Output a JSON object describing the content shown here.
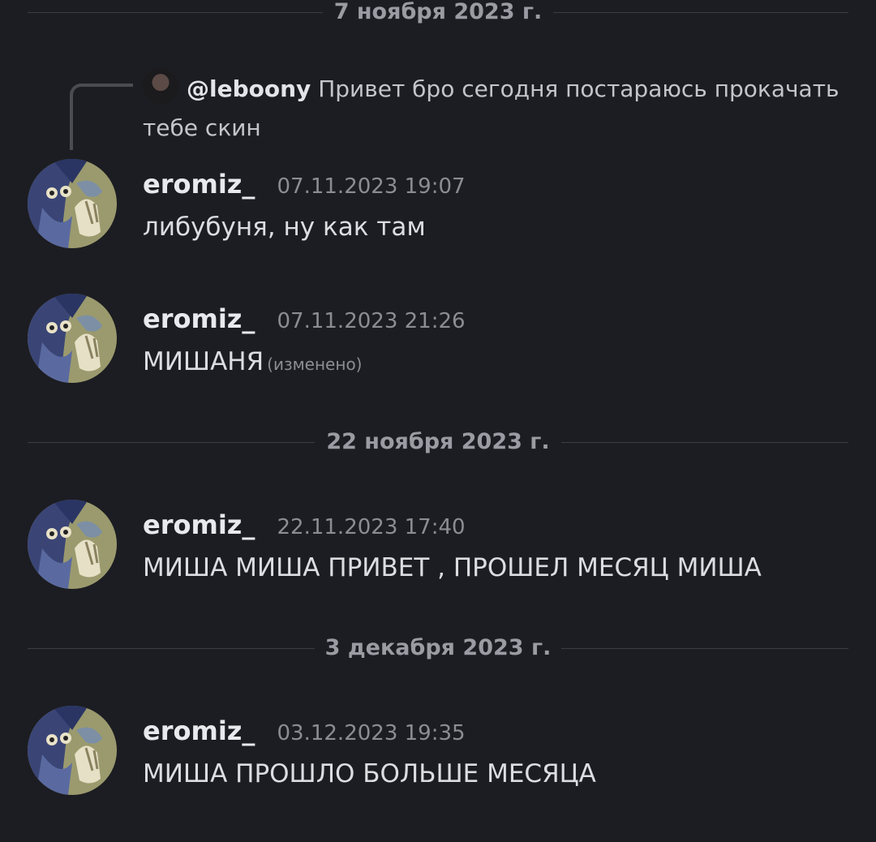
{
  "dates": [
    "7 ноября 2023 г.",
    "22 ноября 2023 г.",
    "3 декабря 2023 г."
  ],
  "reply": {
    "mention": "@leboony",
    "text": "Привет бро сегодня постараюсь прокачать тебе скин"
  },
  "messages": [
    {
      "author": "eromiz_",
      "time": "07.11.2023 19:07",
      "text": "либубуня, ну как там"
    },
    {
      "author": "eromiz_",
      "time": "07.11.2023 21:26",
      "text": "МИШАНЯ",
      "edited": "(изменено)"
    },
    {
      "author": "eromiz_",
      "time": "22.11.2023 17:40",
      "text": "МИША МИША ПРИВЕТ , ПРОШЕЛ МЕСЯЦ МИША"
    },
    {
      "author": "eromiz_",
      "time": "03.12.2023 19:35",
      "text": "МИША ПРОШЛО БОЛЬШЕ МЕСЯЦА"
    }
  ]
}
